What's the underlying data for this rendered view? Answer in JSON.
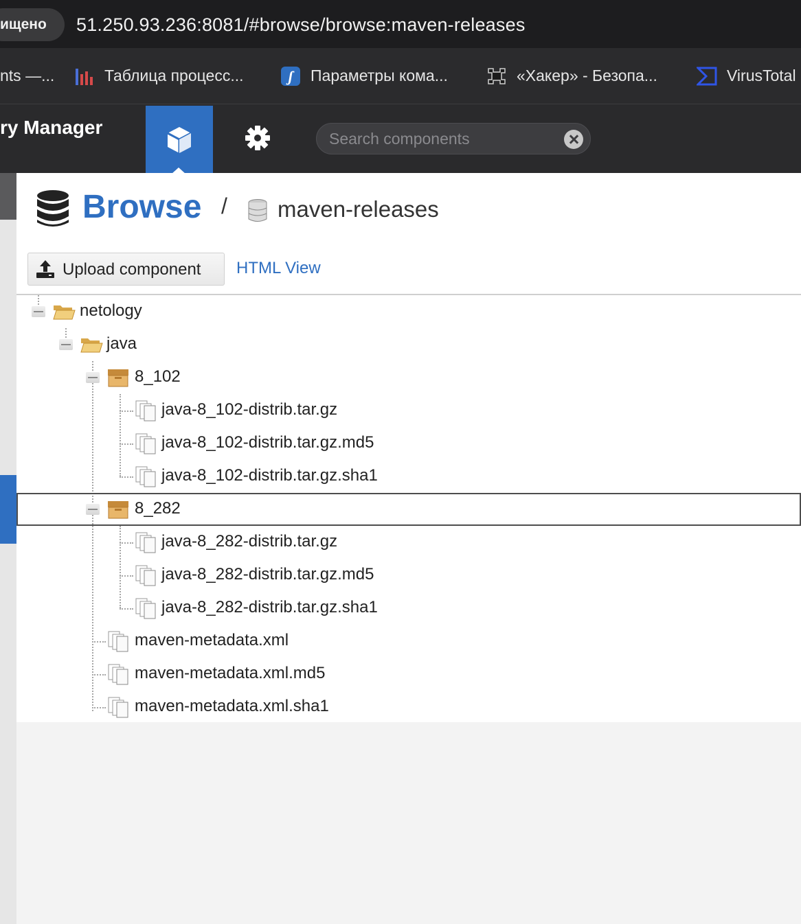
{
  "browser": {
    "security_label": "ищено",
    "url": "51.250.93.236:8081/#browse/browse:maven-releases",
    "bookmarks": [
      {
        "label": "nts —...",
        "icon": "none"
      },
      {
        "label": "Таблица процесс...",
        "icon": "bar-chart-icon"
      },
      {
        "label": "Параметры кома...",
        "icon": "script-icon"
      },
      {
        "label": "«Хакер» - Безопа...",
        "icon": "xakep-logo-icon"
      },
      {
        "label": "VirusTotal",
        "icon": "virustotal-icon"
      }
    ]
  },
  "header": {
    "brand": "ry Manager",
    "search_placeholder": "Search components"
  },
  "page": {
    "title": "Browse",
    "separator": "/",
    "repo_name": "maven-releases",
    "upload_label": "Upload component",
    "html_view_label": "HTML View"
  },
  "tree": {
    "nodes": [
      {
        "label": "netology",
        "type": "folder"
      },
      {
        "label": "java",
        "type": "folder"
      },
      {
        "label": "8_102",
        "type": "component"
      },
      {
        "label": "java-8_102-distrib.tar.gz",
        "type": "asset"
      },
      {
        "label": "java-8_102-distrib.tar.gz.md5",
        "type": "asset"
      },
      {
        "label": "java-8_102-distrib.tar.gz.sha1",
        "type": "asset"
      },
      {
        "label": "8_282",
        "type": "component",
        "selected": true
      },
      {
        "label": "java-8_282-distrib.tar.gz",
        "type": "asset"
      },
      {
        "label": "java-8_282-distrib.tar.gz.md5",
        "type": "asset"
      },
      {
        "label": "java-8_282-distrib.tar.gz.sha1",
        "type": "asset"
      },
      {
        "label": "maven-metadata.xml",
        "type": "asset"
      },
      {
        "label": "maven-metadata.xml.md5",
        "type": "asset"
      },
      {
        "label": "maven-metadata.xml.sha1",
        "type": "asset"
      }
    ]
  },
  "colors": {
    "accent": "#2f6fc1",
    "header_bg": "#2a2a2c",
    "folder": "#e9c36a",
    "component": "#d9a65a"
  }
}
